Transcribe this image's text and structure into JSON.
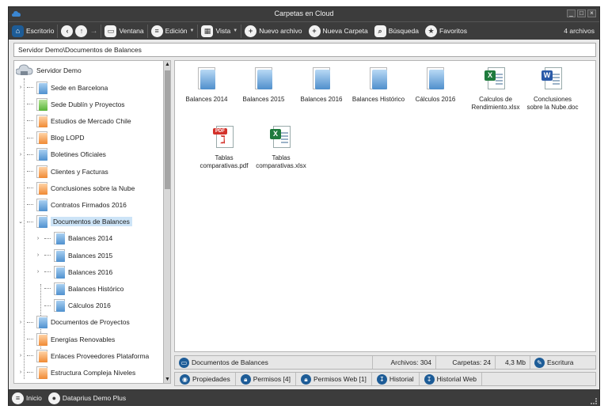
{
  "window": {
    "title": "Carpetas en Cloud"
  },
  "colors": {
    "chrome": "#3c3c3c",
    "accent": "#1d5c97",
    "selection": "#cde4f7"
  },
  "toolbar": {
    "home_label": "Escritorio",
    "window_label": "Ventana",
    "edit_label": "Edición",
    "view_label": "Vista",
    "new_file_label": "Nuevo archivo",
    "new_folder_label": "Nueva Carpeta",
    "search_label": "Búsqueda",
    "favorites_label": "Favoritos",
    "file_count": "4 archivos"
  },
  "path": "Servidor Demo\\Documentos de Balances",
  "tree": {
    "root": "Servidor Demo",
    "items": [
      {
        "label": "Sede en Barcelona",
        "color": "blue",
        "expander": "›"
      },
      {
        "label": "Sede Dublín y Proyectos",
        "color": "green",
        "expander": ""
      },
      {
        "label": "Estudios de Mercado Chile",
        "color": "orange",
        "expander": ""
      },
      {
        "label": "Blog LOPD",
        "color": "orange",
        "expander": ""
      },
      {
        "label": "Boletines Oficiales",
        "color": "blue",
        "expander": "›"
      },
      {
        "label": "Clientes y Facturas",
        "color": "orange",
        "expander": ""
      },
      {
        "label": "Conclusiones sobre la Nube",
        "color": "orange",
        "expander": ""
      },
      {
        "label": "Contratos Firmados 2016",
        "color": "blue",
        "expander": ""
      },
      {
        "label": "Documentos de Balances",
        "color": "blue",
        "expander": "⌄"
      },
      {
        "label": "Balances 2014",
        "color": "blue",
        "expander": "›"
      },
      {
        "label": "Balances 2015",
        "color": "blue",
        "expander": "›"
      },
      {
        "label": "Balances 2016",
        "color": "blue",
        "expander": "›"
      },
      {
        "label": "Balances Histórico",
        "color": "blue",
        "expander": ""
      },
      {
        "label": "Cálculos 2016",
        "color": "blue",
        "expander": ""
      },
      {
        "label": "Documentos de Proyectos",
        "color": "blue",
        "expander": "›"
      },
      {
        "label": "Energías Renovables",
        "color": "orange",
        "expander": ""
      },
      {
        "label": "Enlaces Proveedores Plataforma",
        "color": "orange",
        "expander": "›"
      },
      {
        "label": "Estructura Compleja Niveles",
        "color": "orange",
        "expander": "›"
      }
    ]
  },
  "files": [
    {
      "name": "Balances 2014",
      "type": "folder"
    },
    {
      "name": "Balances 2015",
      "type": "folder"
    },
    {
      "name": "Balances 2016",
      "type": "folder"
    },
    {
      "name": "Balances Histórico",
      "type": "folder"
    },
    {
      "name": "Cálculos 2016",
      "type": "folder"
    },
    {
      "name": "Calculos de Rendimiento.xlsx",
      "type": "xlsx"
    },
    {
      "name": "Conclusiones sobre la Nube.doc",
      "type": "doc"
    },
    {
      "name": "Tablas comparativas.pdf",
      "type": "pdf"
    },
    {
      "name": "Tablas comparativas.xlsx",
      "type": "xlsx"
    }
  ],
  "status": {
    "folder": "Documentos de Balances",
    "files": "Archivos: 304",
    "folders": "Carpetas: 24",
    "size": "4,3 Mb",
    "write": "Escritura"
  },
  "tabs": [
    "Propiedades",
    "Permisos [4]",
    "Permisos Web [1]",
    "Historial",
    "Historial Web"
  ],
  "footer": {
    "start_label": "Inicio",
    "user_label": "Dataprius Demo Plus"
  }
}
